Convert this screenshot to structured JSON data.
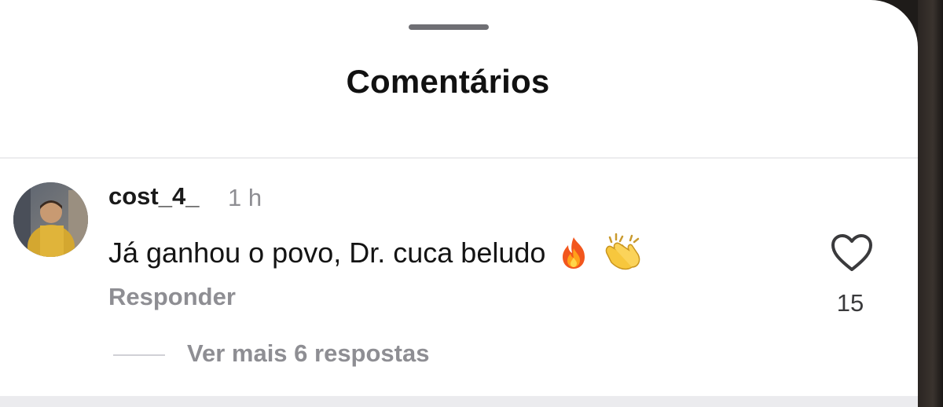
{
  "header": {
    "title": "Comentários"
  },
  "comment": {
    "username": "cost_4_",
    "time": "1 h",
    "text": "Já ganhou o povo, Dr. cuca beludo",
    "emojis": [
      "fire-emoji",
      "clapping-hands-emoji"
    ],
    "reply_label": "Responder",
    "like_icon": "heart-outline-icon",
    "like_count": "15"
  },
  "replies": {
    "view_more_label": "Ver mais 6 respostas"
  },
  "colors": {
    "background": "#ffffff",
    "primary_text": "#111111",
    "secondary_text": "#8e8e93",
    "divider": "#ececee"
  }
}
